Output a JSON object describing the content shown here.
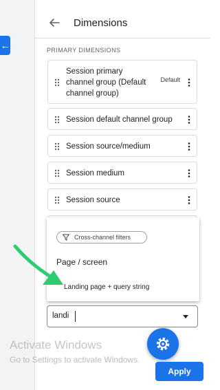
{
  "app": {
    "header": {
      "title": "Dimensions"
    },
    "section_label": "PRIMARY DIMENSIONS",
    "dimensions": [
      {
        "label": "Session primary channel group (Default channel group)",
        "lines": [
          "Session primary",
          "channel group (Default",
          "channel group)"
        ],
        "tag": "Default"
      },
      {
        "label": "Session default channel group"
      },
      {
        "label": "Session source/medium"
      },
      {
        "label": "Session medium"
      },
      {
        "label": "Session source"
      }
    ],
    "dropdown": {
      "chip_label": "Cross-channel filters",
      "options": [
        "Page / screen",
        "Landing page + query string"
      ]
    },
    "search": {
      "value": "landi"
    },
    "apply_label": "Apply",
    "colors": {
      "accent": "#1a73e8",
      "arrow": "#2ecc71"
    },
    "icons": [
      "back-arrow-icon",
      "drag-handle-icon",
      "more-vert-icon",
      "filter-icon",
      "dropdown-arrow-icon",
      "settings-gear-icon"
    ]
  },
  "watermark": {
    "line1": "Activate Windows",
    "line2": "Go to Settings to activate Windows."
  }
}
